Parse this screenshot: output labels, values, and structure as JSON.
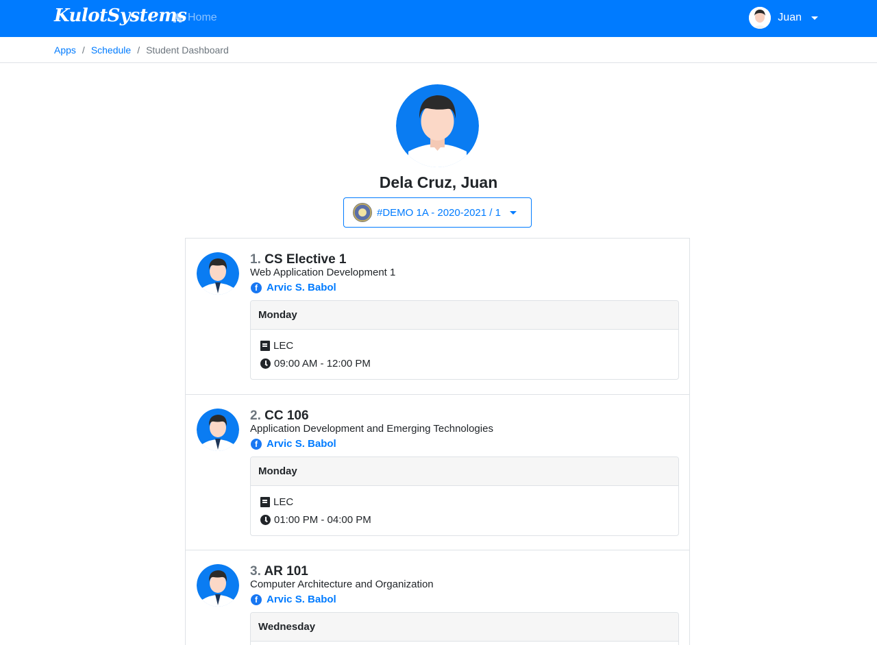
{
  "navbar": {
    "brand": "KulotSystems",
    "home_label": "Home",
    "user_label": "Juan",
    "color": "#007bff"
  },
  "breadcrumb": {
    "items": [
      "Apps",
      "Schedule"
    ],
    "active": "Student Dashboard"
  },
  "profile": {
    "name": "Dela Cruz, Juan",
    "term_selector": "#DEMO 1A - 2020-2021 / 1"
  },
  "schedule": [
    {
      "number": "1.",
      "code": "CS Elective 1",
      "description": "Web Application Development 1",
      "teacher": "Arvic S. Babol",
      "day": "Monday",
      "type": "LEC",
      "time": "09:00 AM - 12:00 PM"
    },
    {
      "number": "2.",
      "code": "CC 106",
      "description": "Application Development and Emerging Technologies",
      "teacher": "Arvic S. Babol",
      "day": "Monday",
      "type": "LEC",
      "time": "01:00 PM - 04:00 PM"
    },
    {
      "number": "3.",
      "code": "AR 101",
      "description": "Computer Architecture and Organization",
      "teacher": "Arvic S. Babol",
      "day": "Wednesday"
    }
  ]
}
